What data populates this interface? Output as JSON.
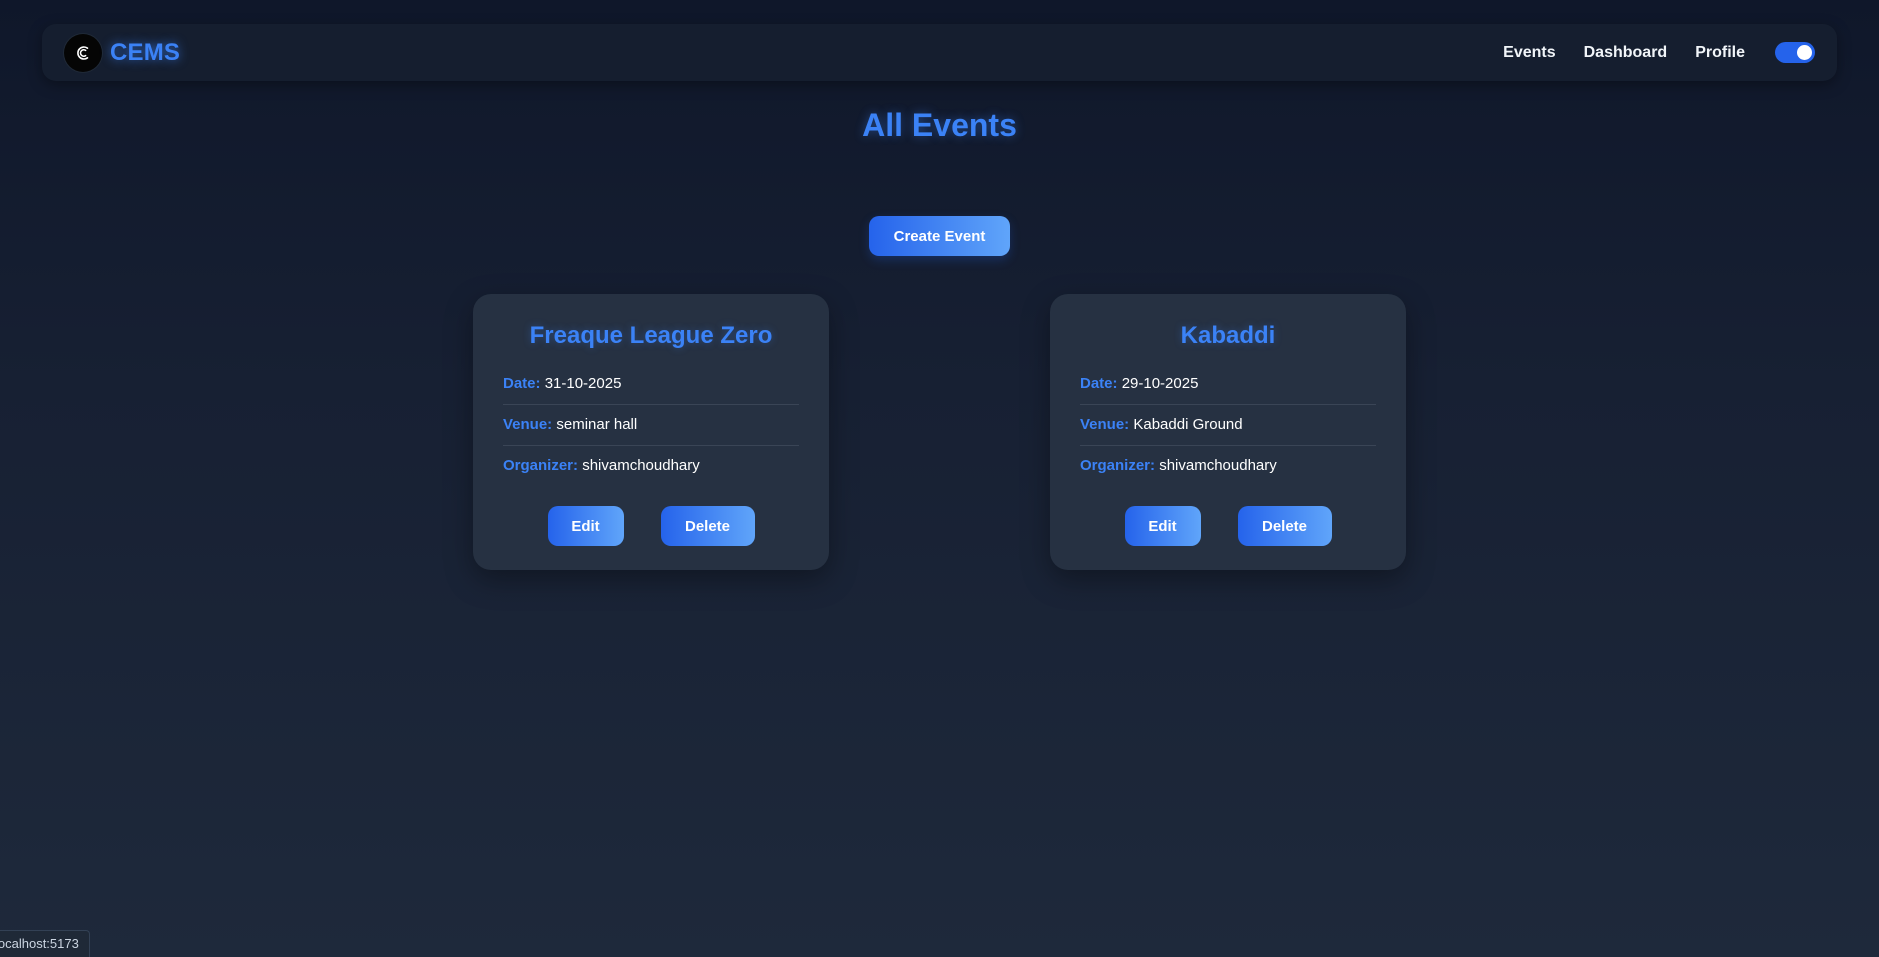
{
  "navbar": {
    "brand": "CEMS",
    "links": [
      "Events",
      "Dashboard",
      "Profile"
    ],
    "theme_toggle_on": true
  },
  "page": {
    "title": "All Events",
    "create_button": "Create Event"
  },
  "events": [
    {
      "title": "Freaque League Zero",
      "date_label": "Date:",
      "date": "31-10-2025",
      "venue_label": "Venue:",
      "venue": "seminar hall",
      "organizer_label": "Organizer:",
      "organizer": "shivamchoudhary",
      "edit_label": "Edit",
      "delete_label": "Delete"
    },
    {
      "title": "Kabaddi",
      "date_label": "Date:",
      "date": "29-10-2025",
      "venue_label": "Venue:",
      "venue": "Kabaddi Ground",
      "organizer_label": "Organizer:",
      "organizer": "shivamchoudhary",
      "edit_label": "Edit",
      "delete_label": "Delete"
    }
  ],
  "status_bar": {
    "url": "localhost:5173"
  },
  "colors": {
    "accent": "#3b82f6",
    "button_gradient_start": "#2563eb",
    "button_gradient_end": "#60a5fa",
    "card_bg": "#263142",
    "navbar_bg": "#151e2f"
  },
  "icons": {
    "logo": "cems-logo-icon"
  }
}
